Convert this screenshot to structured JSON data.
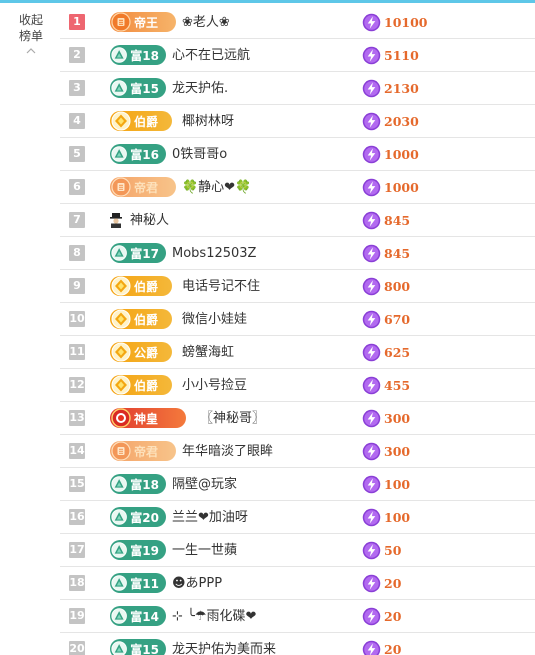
{
  "collapse": {
    "line1": "收起",
    "line2": "榜单",
    "caret": "chevron-up-icon"
  },
  "colors": {
    "rank_first": "#ee6670",
    "rank_other": "#c4c4c4",
    "score": "#e5692c",
    "fu_badge": "#35a183",
    "bo_badge": "#f5a412",
    "di_badge": "#f28a3e",
    "shen_badge": "#e03a2f",
    "accent_bar": "#5ec7e8"
  },
  "rows": [
    {
      "rank": "1",
      "badge_type": "di",
      "badge_label": "帝王",
      "name": "❀老人❀",
      "score": "10100"
    },
    {
      "rank": "2",
      "badge_type": "fu",
      "badge_label": "富18",
      "name": "心不在已远航",
      "score": "5110"
    },
    {
      "rank": "3",
      "badge_type": "fu",
      "badge_label": "富15",
      "name": "龙天护佑.",
      "score": "2130"
    },
    {
      "rank": "4",
      "badge_type": "bo",
      "badge_label": "伯爵",
      "name": "椰树林呀",
      "score": "2030"
    },
    {
      "rank": "5",
      "badge_type": "fu",
      "badge_label": "富16",
      "name": "0铁哥哥o",
      "score": "1000"
    },
    {
      "rank": "6",
      "badge_type": "di-faded",
      "badge_label": "帝君",
      "name": "🍀静心❤🍀",
      "score": "1000"
    },
    {
      "rank": "7",
      "badge_type": "none",
      "badge_label": "",
      "name": "神秘人",
      "score": "845",
      "avatar": "mystery-avatar-icon"
    },
    {
      "rank": "8",
      "badge_type": "fu",
      "badge_label": "富17",
      "name": "Mobs12503Z",
      "score": "845"
    },
    {
      "rank": "9",
      "badge_type": "bo",
      "badge_label": "伯爵",
      "name": "电话号记不住",
      "score": "800"
    },
    {
      "rank": "10",
      "badge_type": "bo",
      "badge_label": "伯爵",
      "name": "微信小娃娃",
      "score": "670"
    },
    {
      "rank": "11",
      "badge_type": "bo",
      "badge_label": "公爵",
      "name": "螃蟹海虹",
      "score": "625"
    },
    {
      "rank": "12",
      "badge_type": "bo",
      "badge_label": "伯爵",
      "name": "小小号捡豆",
      "score": "455"
    },
    {
      "rank": "13",
      "badge_type": "shen",
      "badge_label": "神皇",
      "name": "〖神秘哥〗",
      "score": "300"
    },
    {
      "rank": "14",
      "badge_type": "di-faded",
      "badge_label": "帝君",
      "name": "年华暗淡了眼眸",
      "score": "300"
    },
    {
      "rank": "15",
      "badge_type": "fu",
      "badge_label": "富18",
      "name": "隔壁@玩家",
      "score": "100"
    },
    {
      "rank": "16",
      "badge_type": "fu",
      "badge_label": "富20",
      "name": "兰兰❤加油呀",
      "score": "100"
    },
    {
      "rank": "17",
      "badge_type": "fu",
      "badge_label": "富19",
      "name": "一生一世蘋",
      "score": "50"
    },
    {
      "rank": "18",
      "badge_type": "fu",
      "badge_label": "富11",
      "name": "☻あPPP",
      "score": "20"
    },
    {
      "rank": "19",
      "badge_type": "fu",
      "badge_label": "富14",
      "name": "⊹ ╰☂雨化碟❤",
      "score": "20"
    },
    {
      "rank": "20",
      "badge_type": "fu",
      "badge_label": "富15",
      "name": "龙天护佑为美而来",
      "score": "20"
    }
  ]
}
